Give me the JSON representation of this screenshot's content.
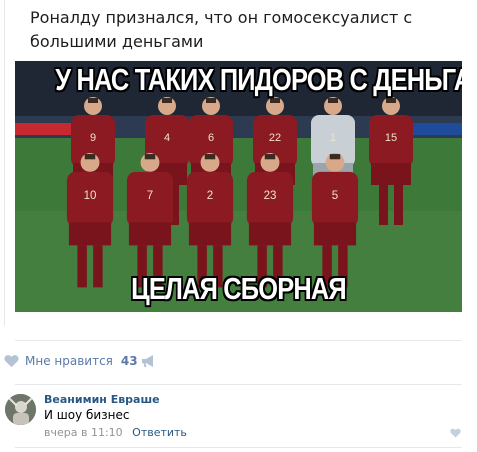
{
  "post": {
    "text": "Роналду признался, что он гомосексуалист с большими деньгами"
  },
  "image": {
    "top_caption": "У НАС ТАКИХ ПИДОРОВ С ДЕНЬГАМИ",
    "bottom_caption": "ЦЕЛАЯ СБОРНАЯ",
    "jersey_numbers_back": [
      "9",
      "4",
      "6",
      "22",
      "1",
      "15"
    ],
    "jersey_numbers_front": [
      "10",
      "7",
      "2",
      "23",
      "5"
    ],
    "kit_color": "#8b1a22",
    "keeper_color": "#c8d0d6",
    "pitch_color": "#3d7a3a"
  },
  "actions": {
    "like_label": "Мне нравится",
    "like_count": "43",
    "like_icon": "heart-icon",
    "share_icon": "megaphone-icon"
  },
  "comment": {
    "author": "Веанимин Евраше",
    "text": "И шоу бизнес",
    "time": "вчера в 11:10",
    "reply_label": "Ответить",
    "like_icon": "heart-icon"
  },
  "colors": {
    "link": "#2a5885",
    "muted": "#939393",
    "icon": "#b4c2d5",
    "divider": "#e7e8ec"
  }
}
